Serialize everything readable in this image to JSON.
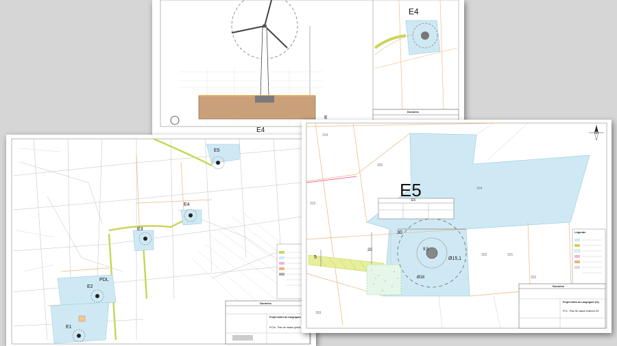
{
  "back_sheet": {
    "title": "E4",
    "circle_marker": "E",
    "inset_label": "E4",
    "cartouche_header": "Données"
  },
  "left_sheet": {
    "turbines": [
      "E1",
      "E2",
      "E3",
      "E4",
      "E5"
    ],
    "pdl_label": "PDL",
    "cartouche_header": "Données",
    "project_title": "Projet éolien de Langrigues (11)",
    "plan_title": "PC2a - Plan de masse global"
  },
  "right_sheet": {
    "title": "E5",
    "parcels": [
      "314",
      "305",
      "304",
      "315",
      "303",
      "301",
      "302",
      "359"
    ],
    "table_header": "E5",
    "dim_30": "30",
    "dim_5": "5",
    "dim_20": "20",
    "dim_radius": "Ø15,1",
    "dim_9": "9,5",
    "dim_16": "Ø16",
    "cartouche_header": "Données",
    "project_title": "Projet éolien de Langrigues (11)",
    "plan_title": "PC2 : Plan de masse éolienne E5",
    "legend_title": "Légende"
  },
  "colors": {
    "zone_fill": "#cfe9f4",
    "road": "#c8d65a",
    "parcel_line": "#e8b47a",
    "hatch": "#7fcf8a"
  }
}
